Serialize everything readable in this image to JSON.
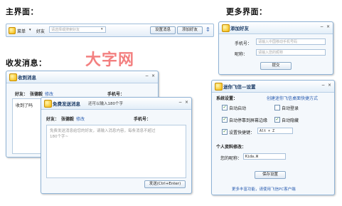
{
  "headings": {
    "main_ui": "主界面：",
    "more_ui": "更多界面：",
    "messaging": "收发消息：",
    "watermark": "大字网"
  },
  "main_bar": {
    "menu_label": "菜单",
    "friend_label": "好友",
    "search_placeholder": "请选择或搜索好友",
    "settings_button": "设置消息",
    "add_friend_button": "添加好友"
  },
  "add_friend_window": {
    "title": "添加好友",
    "phone_label": "手机号：",
    "phone_placeholder": "请输入中国移动手机号码",
    "nickname_label": "昵称：",
    "nickname_placeholder": "请输入您的昵称",
    "submit_button": "提交"
  },
  "receive_window": {
    "title": "收到消息",
    "friend_label": "好友：",
    "friend_name": "张德毅",
    "modify_link": "修改",
    "phone_label": "手机号：",
    "message_text": "收到了吗"
  },
  "send_window": {
    "title": "免费发送消息",
    "subtitle": "还可以输入180个字",
    "friend_label": "好友：",
    "friend_name": "张德毅",
    "modify_link": "修改",
    "phone_label": "手机号：",
    "message_placeholder": "免费发送消息给您的好友，请输入消息内容，每条消息不超过180个字~",
    "send_button": "发送(Ctrl+Enter)"
  },
  "settings_window": {
    "title": "迷你飞信—设置",
    "system_label": "系统设置：",
    "desktop_shortcut_link": "创建迷你飞信桌面快捷方式",
    "options": [
      {
        "label": "自动启动",
        "checked": true
      },
      {
        "label": "自动登录",
        "checked": false
      },
      {
        "label": "自动停靠到屏幕边缘",
        "checked": true
      },
      {
        "label": "自动隐藏",
        "checked": true
      },
      {
        "label": "设置快捷键：",
        "checked": true
      }
    ],
    "hotkey_value": "Alt + Z",
    "profile_label": "个人资料修改：",
    "nickname_label": "您的昵称：",
    "nickname_value": "Kida.W",
    "save_button": "保存设置",
    "footer_link": "更多丰富功能，请使用飞信PC客户端"
  }
}
